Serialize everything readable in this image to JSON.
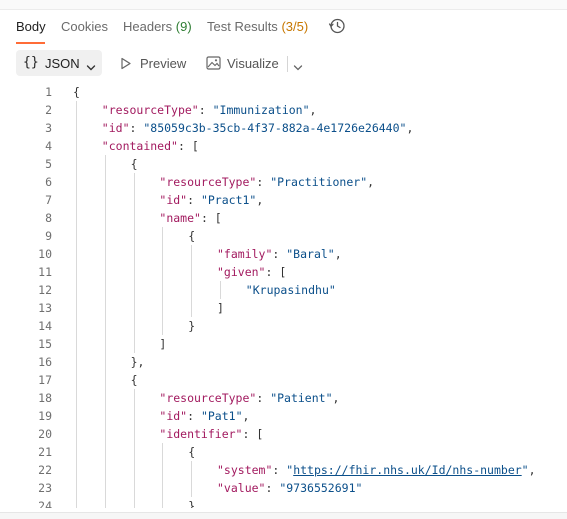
{
  "tabs": {
    "body": "Body",
    "cookies": "Cookies",
    "headers": "Headers",
    "headers_count": "(9)",
    "tests": "Test Results",
    "tests_count": "(3/5)"
  },
  "toolbar": {
    "format_braces": "{}",
    "format_label": "JSON",
    "preview_label": "Preview",
    "visualize_label": "Visualize"
  },
  "colors": {
    "accent": "#ff6c37",
    "json_key": "#a21a5f",
    "json_string": "#0b4f8a",
    "count_pass": "#2e7d32",
    "count_partial": "#c77700"
  },
  "icons": {
    "history": "history-icon",
    "preview": "play-icon",
    "visualize": "image-icon",
    "dropdown": "chevron-down-icon"
  },
  "code_lines": [
    {
      "n": "1",
      "indent": 0,
      "parts": [
        [
          "p",
          "{"
        ]
      ]
    },
    {
      "n": "2",
      "indent": 1,
      "parts": [
        [
          "k",
          "\"resourceType\""
        ],
        [
          "p",
          ": "
        ],
        [
          "s",
          "\"Immunization\""
        ],
        [
          "p",
          ","
        ]
      ]
    },
    {
      "n": "3",
      "indent": 1,
      "parts": [
        [
          "k",
          "\"id\""
        ],
        [
          "p",
          ": "
        ],
        [
          "s",
          "\"85059c3b-35cb-4f37-882a-4e1726e26440\""
        ],
        [
          "p",
          ","
        ]
      ]
    },
    {
      "n": "4",
      "indent": 1,
      "parts": [
        [
          "k",
          "\"contained\""
        ],
        [
          "p",
          ": ["
        ]
      ]
    },
    {
      "n": "5",
      "indent": 2,
      "parts": [
        [
          "p",
          "{"
        ]
      ]
    },
    {
      "n": "6",
      "indent": 3,
      "parts": [
        [
          "k",
          "\"resourceType\""
        ],
        [
          "p",
          ": "
        ],
        [
          "s",
          "\"Practitioner\""
        ],
        [
          "p",
          ","
        ]
      ]
    },
    {
      "n": "7",
      "indent": 3,
      "parts": [
        [
          "k",
          "\"id\""
        ],
        [
          "p",
          ": "
        ],
        [
          "s",
          "\"Pract1\""
        ],
        [
          "p",
          ","
        ]
      ]
    },
    {
      "n": "8",
      "indent": 3,
      "parts": [
        [
          "k",
          "\"name\""
        ],
        [
          "p",
          ": ["
        ]
      ]
    },
    {
      "n": "9",
      "indent": 4,
      "parts": [
        [
          "p",
          "{"
        ]
      ]
    },
    {
      "n": "10",
      "indent": 5,
      "parts": [
        [
          "k",
          "\"family\""
        ],
        [
          "p",
          ": "
        ],
        [
          "s",
          "\"Baral\""
        ],
        [
          "p",
          ","
        ]
      ]
    },
    {
      "n": "11",
      "indent": 5,
      "parts": [
        [
          "k",
          "\"given\""
        ],
        [
          "p",
          ": ["
        ]
      ]
    },
    {
      "n": "12",
      "indent": 6,
      "parts": [
        [
          "s",
          "\"Krupasindhu\""
        ]
      ]
    },
    {
      "n": "13",
      "indent": 5,
      "parts": [
        [
          "p",
          "]"
        ]
      ]
    },
    {
      "n": "14",
      "indent": 4,
      "parts": [
        [
          "p",
          "}"
        ]
      ]
    },
    {
      "n": "15",
      "indent": 3,
      "parts": [
        [
          "p",
          "]"
        ]
      ]
    },
    {
      "n": "16",
      "indent": 2,
      "parts": [
        [
          "p",
          "},"
        ]
      ]
    },
    {
      "n": "17",
      "indent": 2,
      "parts": [
        [
          "p",
          "{"
        ]
      ]
    },
    {
      "n": "18",
      "indent": 3,
      "parts": [
        [
          "k",
          "\"resourceType\""
        ],
        [
          "p",
          ": "
        ],
        [
          "s",
          "\"Patient\""
        ],
        [
          "p",
          ","
        ]
      ]
    },
    {
      "n": "19",
      "indent": 3,
      "parts": [
        [
          "k",
          "\"id\""
        ],
        [
          "p",
          ": "
        ],
        [
          "s",
          "\"Pat1\""
        ],
        [
          "p",
          ","
        ]
      ]
    },
    {
      "n": "20",
      "indent": 3,
      "parts": [
        [
          "k",
          "\"identifier\""
        ],
        [
          "p",
          ": ["
        ]
      ]
    },
    {
      "n": "21",
      "indent": 4,
      "parts": [
        [
          "p",
          "{"
        ]
      ]
    },
    {
      "n": "22",
      "indent": 5,
      "parts": [
        [
          "k",
          "\"system\""
        ],
        [
          "p",
          ": "
        ],
        [
          "s",
          "\""
        ],
        [
          "link",
          "https://fhir.nhs.uk/Id/nhs-number"
        ],
        [
          "s",
          "\""
        ],
        [
          "p",
          ","
        ]
      ]
    },
    {
      "n": "23",
      "indent": 5,
      "parts": [
        [
          "k",
          "\"value\""
        ],
        [
          "p",
          ": "
        ],
        [
          "s",
          "\"9736552691\""
        ]
      ]
    },
    {
      "n": "24",
      "indent": 4,
      "parts": [
        [
          "p",
          "}"
        ]
      ]
    }
  ]
}
